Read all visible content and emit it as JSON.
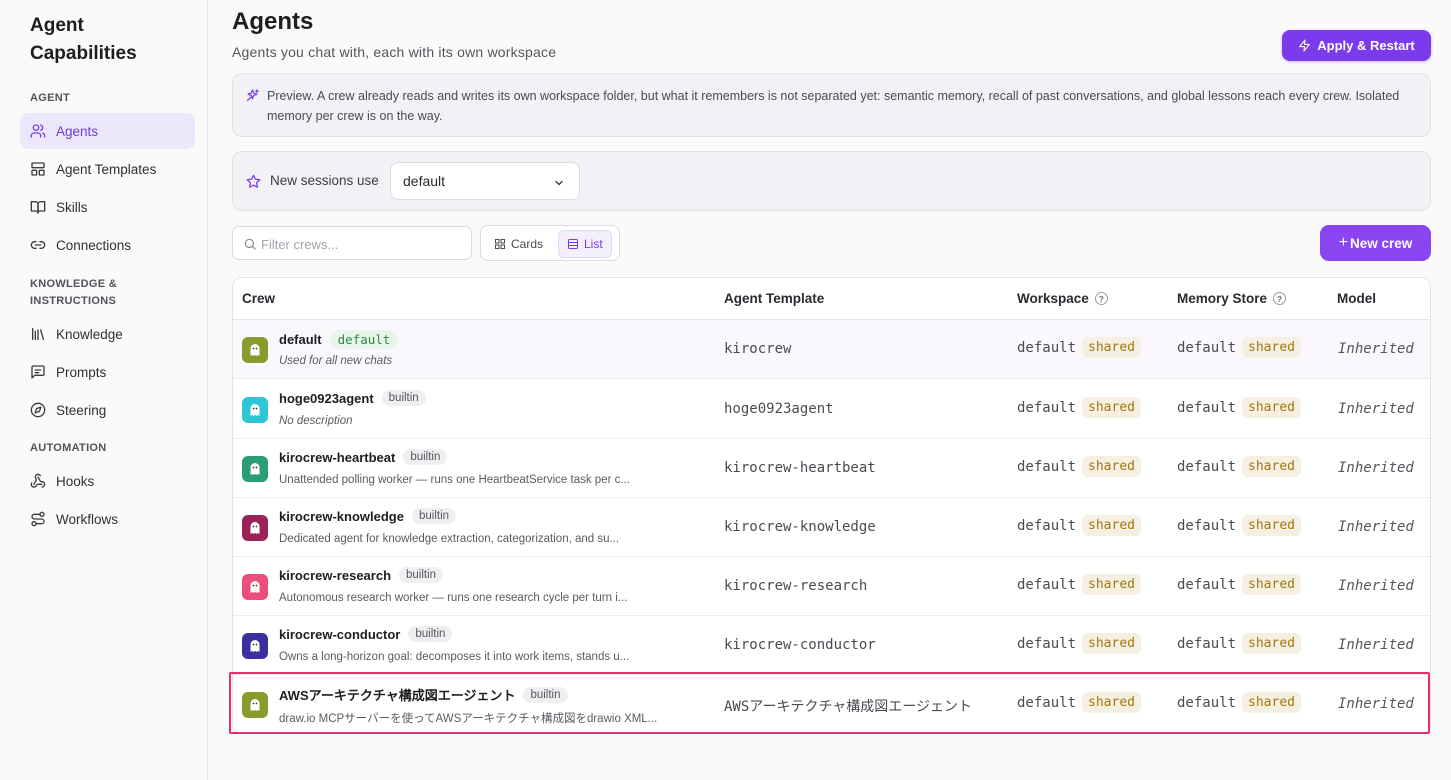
{
  "sidebar": {
    "title": "Agent Capabilities",
    "sections": [
      {
        "label": "AGENT"
      },
      {
        "label": "KNOWLEDGE & INSTRUCTIONS"
      },
      {
        "label": "AUTOMATION"
      }
    ],
    "items": [
      {
        "label": "Agents",
        "icon": "users-icon",
        "active": true
      },
      {
        "label": "Agent Templates",
        "icon": "template-icon"
      },
      {
        "label": "Skills",
        "icon": "book-icon"
      },
      {
        "label": "Connections",
        "icon": "link-icon"
      },
      {
        "label": "Knowledge",
        "icon": "library-icon"
      },
      {
        "label": "Prompts",
        "icon": "message-icon"
      },
      {
        "label": "Steering",
        "icon": "compass-icon"
      },
      {
        "label": "Hooks",
        "icon": "webhook-icon"
      },
      {
        "label": "Workflows",
        "icon": "workflow-icon"
      }
    ]
  },
  "header": {
    "title": "Agents",
    "subtitle": "Agents you chat with, each with its own workspace",
    "apply_label": "Apply & Restart"
  },
  "preview": {
    "text": "Preview. A crew already reads and writes its own workspace folder, but what it remembers is not separated yet: semantic memory, recall of past conversations, and global lessons reach every crew. Isolated memory per crew is on the way."
  },
  "sessions": {
    "label": "New sessions use",
    "selected": "default"
  },
  "toolbar": {
    "filter_placeholder": "Filter crews...",
    "cards_label": "Cards",
    "list_label": "List",
    "new_crew_label": "New crew"
  },
  "table": {
    "headers": {
      "crew": "Crew",
      "template": "Agent Template",
      "workspace": "Workspace",
      "memory": "Memory Store",
      "model": "Model"
    },
    "rows": [
      {
        "name": "default",
        "badge": "default",
        "badge_type": "default",
        "desc": "Used for all new chats",
        "desc_italic": true,
        "template": "kirocrew",
        "workspace": "default",
        "workspace_tag": "shared",
        "memory": "default",
        "memory_tag": "shared",
        "model": "Inherited",
        "avatar_color": "#8a9a2b"
      },
      {
        "name": "hoge0923agent",
        "badge": "builtin",
        "badge_type": "builtin",
        "desc": "No description",
        "desc_italic": true,
        "template": "hoge0923agent",
        "workspace": "default",
        "workspace_tag": "shared",
        "memory": "default",
        "memory_tag": "shared",
        "model": "Inherited",
        "avatar_color": "#2ec6d6"
      },
      {
        "name": "kirocrew-heartbeat",
        "badge": "builtin",
        "badge_type": "builtin",
        "desc": "Unattended polling worker — runs one HeartbeatService task per c...",
        "desc_italic": false,
        "template": "kirocrew-heartbeat",
        "workspace": "default",
        "workspace_tag": "shared",
        "memory": "default",
        "memory_tag": "shared",
        "model": "Inherited",
        "avatar_color": "#2a9d76"
      },
      {
        "name": "kirocrew-knowledge",
        "badge": "builtin",
        "badge_type": "builtin",
        "desc": "Dedicated agent for knowledge extraction, categorization, and su...",
        "desc_italic": false,
        "template": "kirocrew-knowledge",
        "workspace": "default",
        "workspace_tag": "shared",
        "memory": "default",
        "memory_tag": "shared",
        "model": "Inherited",
        "avatar_color": "#9b2257"
      },
      {
        "name": "kirocrew-research",
        "badge": "builtin",
        "badge_type": "builtin",
        "desc": "Autonomous research worker — runs one research cycle per turn i...",
        "desc_italic": false,
        "template": "kirocrew-research",
        "workspace": "default",
        "workspace_tag": "shared",
        "memory": "default",
        "memory_tag": "shared",
        "model": "Inherited",
        "avatar_color": "#ec4d7c"
      },
      {
        "name": "kirocrew-conductor",
        "badge": "builtin",
        "badge_type": "builtin",
        "desc": "Owns a long-horizon goal: decomposes it into work items, stands u...",
        "desc_italic": false,
        "template": "kirocrew-conductor",
        "workspace": "default",
        "workspace_tag": "shared",
        "memory": "default",
        "memory_tag": "shared",
        "model": "Inherited",
        "avatar_color": "#3b2fa0"
      },
      {
        "name": "AWSアーキテクチャ構成図エージェント",
        "badge": "builtin",
        "badge_type": "builtin",
        "desc": "draw.io MCPサーバーを使ってAWSアーキテクチャ構成図をdrawio XML...",
        "desc_italic": false,
        "template": "AWSアーキテクチャ構成図エージェント",
        "workspace": "default",
        "workspace_tag": "shared",
        "memory": "default",
        "memory_tag": "shared",
        "model": "Inherited",
        "avatar_color": "#8a9a2b"
      }
    ]
  },
  "colors": {
    "accent": "#7c3aed",
    "highlight": "#e82e6d",
    "shared_bg": "#f5f0e1",
    "shared_text": "#a2780f"
  }
}
